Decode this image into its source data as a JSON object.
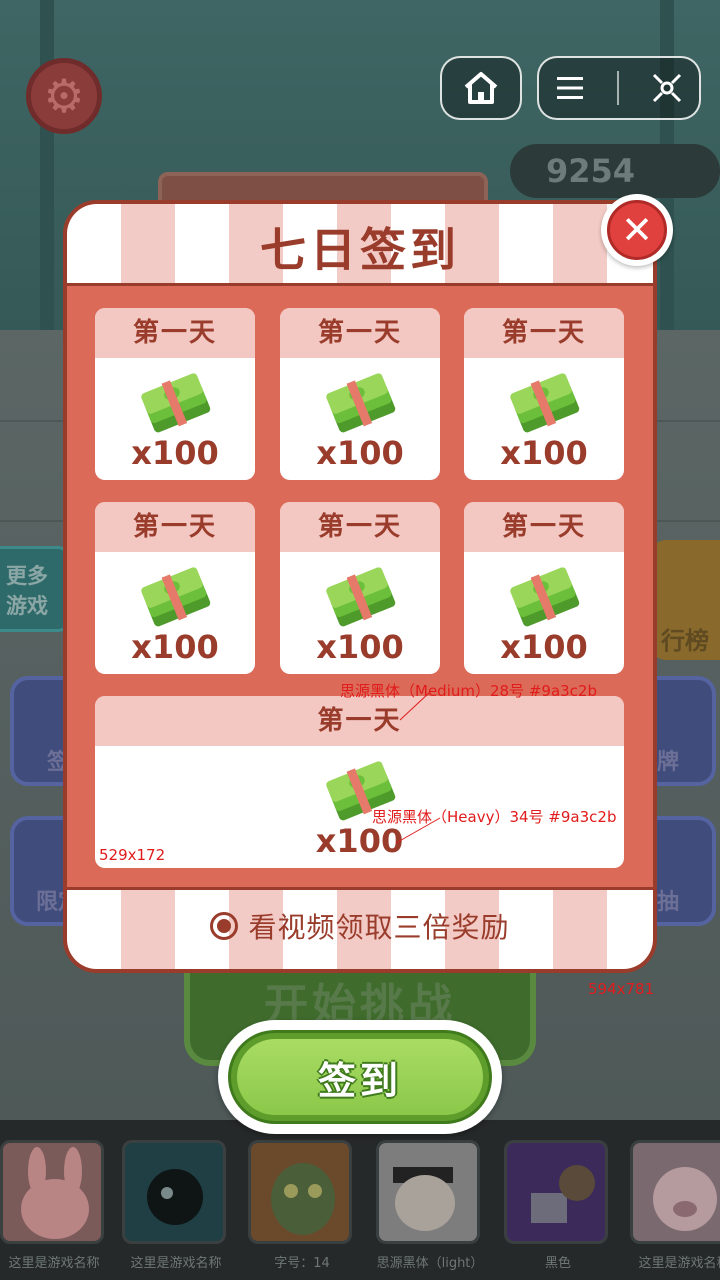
{
  "background": {
    "coins": "9254",
    "more_games_lines": [
      "更多",
      "游戏"
    ],
    "side_labels": {
      "rank": "行榜",
      "left1": "签",
      "left2": "限定",
      "right1": "牌",
      "right2": "抽"
    },
    "start_label": "开始挑战"
  },
  "dialog": {
    "title": "七日签到",
    "days": [
      {
        "label": "第一天",
        "amount": "x100"
      },
      {
        "label": "第一天",
        "amount": "x100"
      },
      {
        "label": "第一天",
        "amount": "x100"
      },
      {
        "label": "第一天",
        "amount": "x100"
      },
      {
        "label": "第一天",
        "amount": "x100"
      },
      {
        "label": "第一天",
        "amount": "x100"
      },
      {
        "label": "第一天",
        "amount": "x100"
      }
    ],
    "bonus_text": "看视频领取三倍奖励",
    "signin_label": "签到"
  },
  "annotations": {
    "label_font": "思源黑体（Medium）28号  #9a3c2b",
    "amount_font": "思源黑体（Heavy）34号  #9a3c2b",
    "card_size": "529x172",
    "dialog_size": "594x781"
  },
  "games": [
    {
      "name": "这里是游戏名称"
    },
    {
      "name": "这里是游戏名称"
    },
    {
      "name": "字号：14"
    },
    {
      "name": "思源黑体（light）"
    },
    {
      "name": "黑色"
    },
    {
      "name": "这里是游戏名称"
    }
  ],
  "colors": {
    "accent": "#9a3c2b",
    "panel": "#db6b58",
    "head": "#f3c7c2",
    "green": "#8bc84a"
  },
  "icons": [
    "gear-icon",
    "home-icon",
    "menu-icon",
    "close-app-icon",
    "cash-stack-icon",
    "close-icon",
    "radio-icon"
  ]
}
